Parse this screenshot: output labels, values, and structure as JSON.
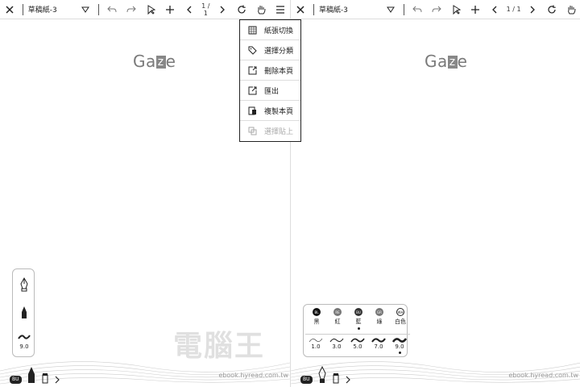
{
  "left": {
    "title": "草稿紙-3",
    "page": "1 / 1",
    "logo_pre": "Ga",
    "logo_z": "z",
    "logo_post": "e",
    "pen_width": "9.0",
    "bu_tag": "BU",
    "url": "ebook.hyread.com.tw"
  },
  "right": {
    "title": "草稿紙-3",
    "page": "1 / 1",
    "logo_pre": "Ga",
    "logo_z": "z",
    "logo_post": "e",
    "bu_tag": "BU",
    "url": "ebook.hyread.com.tw",
    "colors": [
      {
        "code": "BL",
        "label": "黑",
        "hex": "#111111"
      },
      {
        "code": "RE",
        "label": "紅",
        "hex": "#777777"
      },
      {
        "code": "BU",
        "label": "藍",
        "hex": "#333333"
      },
      {
        "code": "GR",
        "label": "綠",
        "hex": "#777777"
      },
      {
        "code": "WH",
        "label": "白色",
        "hex": "#ffffff"
      }
    ],
    "widths": [
      "1.0",
      "3.0",
      "5.0",
      "7.0",
      "9.0"
    ]
  },
  "menu": {
    "items": [
      {
        "label": "紙張切換",
        "icon": "grid-icon"
      },
      {
        "label": "選擇分類",
        "icon": "tag-icon"
      },
      {
        "label": "刪除本頁",
        "icon": "delete-page-icon"
      },
      {
        "label": "匯出",
        "icon": "export-icon"
      },
      {
        "label": "複製本頁",
        "icon": "copy-page-icon"
      },
      {
        "label": "選擇貼上",
        "icon": "paste-icon"
      }
    ]
  },
  "watermark": "電腦王"
}
